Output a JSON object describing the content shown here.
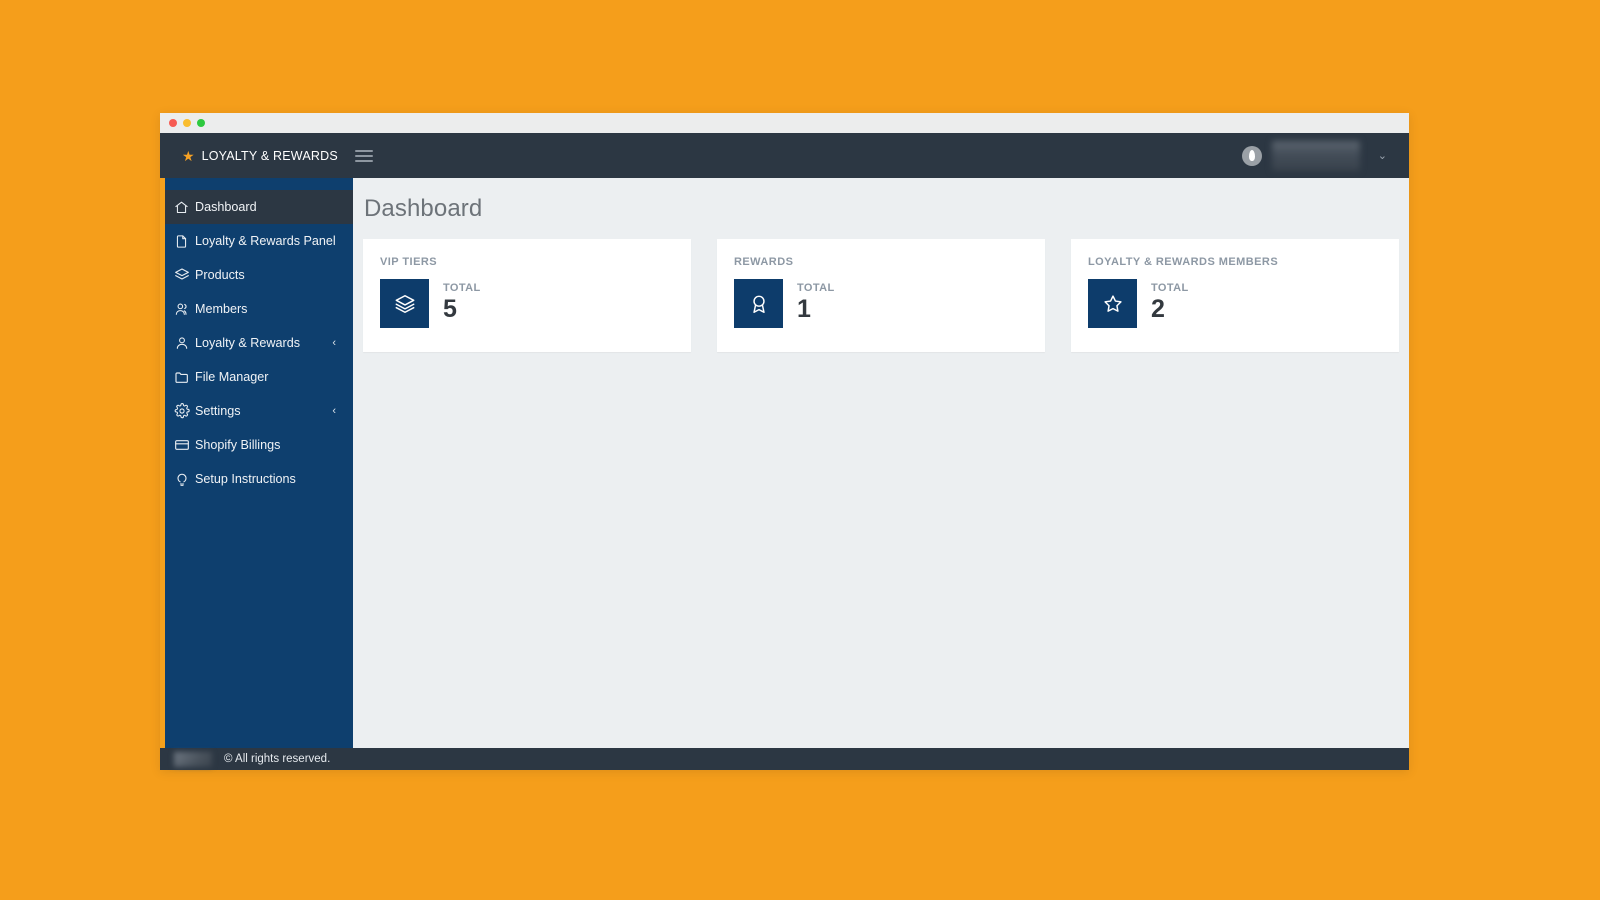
{
  "window": {
    "traffic_lights": [
      "close",
      "minimize",
      "maximize"
    ],
    "colors": {
      "desktop_background": "#f59e1b",
      "sidebar": "#0e3f6e",
      "topbar": "#2c3743",
      "accent_orange": "#f5a11c",
      "card_icon_box": "#0d3c6b",
      "content_background": "#eceff1"
    }
  },
  "topbar": {
    "brand_icon": "star-icon",
    "brand_text": "LOYALTY & REWARDS",
    "menu_toggle_icon": "hamburger-icon",
    "avatar_icon": "user-avatar-icon",
    "username": "",
    "username_redacted": true,
    "dropdown_caret": "⌄"
  },
  "sidebar": {
    "items": [
      {
        "label": "Dashboard",
        "icon": "home-icon",
        "active": true,
        "has_submenu": false
      },
      {
        "label": "Loyalty & Rewards Panel",
        "icon": "file-icon",
        "active": false,
        "has_submenu": false
      },
      {
        "label": "Products",
        "icon": "layers-icon",
        "active": false,
        "has_submenu": false
      },
      {
        "label": "Members",
        "icon": "users-icon",
        "active": false,
        "has_submenu": false
      },
      {
        "label": "Loyalty & Rewards",
        "icon": "user-icon",
        "active": false,
        "has_submenu": true
      },
      {
        "label": "File Manager",
        "icon": "folder-icon",
        "active": false,
        "has_submenu": false
      },
      {
        "label": "Settings",
        "icon": "gear-icon",
        "active": false,
        "has_submenu": true
      },
      {
        "label": "Shopify Billings",
        "icon": "credit-card-icon",
        "active": false,
        "has_submenu": false
      },
      {
        "label": "Setup Instructions",
        "icon": "lightbulb-icon",
        "active": false,
        "has_submenu": false
      }
    ],
    "submenu_chevron": "‹"
  },
  "main": {
    "page_title": "Dashboard",
    "cards": [
      {
        "title": "VIP TIERS",
        "icon": "layers-icon",
        "total_label": "TOTAL",
        "value": "5"
      },
      {
        "title": "REWARDS",
        "icon": "award-ribbon-icon",
        "total_label": "TOTAL",
        "value": "1"
      },
      {
        "title": "LOYALTY & REWARDS MEMBERS",
        "icon": "star-outline-icon",
        "total_label": "TOTAL",
        "value": "2"
      }
    ]
  },
  "footer": {
    "brand_redacted": true,
    "text": "© All rights reserved."
  }
}
